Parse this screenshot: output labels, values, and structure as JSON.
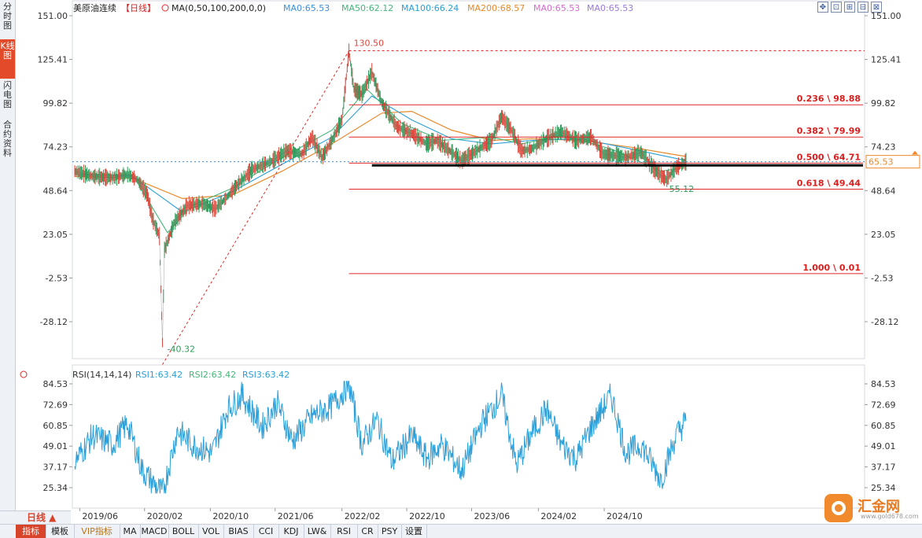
{
  "sidebar": {
    "tabs": [
      {
        "label": "分时图",
        "active": false
      },
      {
        "label": "K线图",
        "active": true
      },
      {
        "label": "闪电图",
        "active": false
      },
      {
        "label": "合约资料",
        "active": false
      }
    ]
  },
  "header": {
    "symbol": "美原油连续",
    "period_tag": "【日线】",
    "ma_label": "MA(0,50,100,200,0,0)",
    "ma_items": [
      {
        "text": "MA0:65.53",
        "color": "#3b8fd9"
      },
      {
        "text": "MA50:62.12",
        "color": "#46b57a"
      },
      {
        "text": "MA100:66.24",
        "color": "#2a9fd8"
      },
      {
        "text": "MA200:68.57",
        "color": "#e8892a"
      },
      {
        "text": "MA0:65.53",
        "color": "#d66ad0"
      },
      {
        "text": "MA0:65.53",
        "color": "#9a7ad8"
      }
    ]
  },
  "tools": [
    "✥",
    "⊡",
    "⊞",
    "⊟",
    "⊠"
  ],
  "price_axis": {
    "ticks": [
      "151.00",
      "125.41",
      "99.82",
      "74.23",
      "48.64",
      "23.05",
      "-2.53",
      "-28.12"
    ],
    "current": "65.53"
  },
  "annotations": {
    "high": "130.50",
    "low": "-40.32",
    "recent_low": "55.12"
  },
  "fib_levels": [
    {
      "label": "0.236 \\ 98.88",
      "value": 98.88
    },
    {
      "label": "0.382 \\ 79.99",
      "value": 79.99
    },
    {
      "label": "0.500 \\ 64.71",
      "value": 64.71
    },
    {
      "label": "0.618 \\ 49.44",
      "value": 49.44
    },
    {
      "label": "1.000 \\ 0.01",
      "value": 0.01
    }
  ],
  "rsi": {
    "label": "RSI(14,14,14)",
    "items": [
      {
        "text": "RSI1:63.42",
        "color": "#2a9fd8"
      },
      {
        "text": "RSI2:63.42",
        "color": "#46b57a"
      },
      {
        "text": "RSI3:63.42",
        "color": "#2a9fd8"
      }
    ],
    "ticks": [
      "84.53",
      "72.69",
      "60.85",
      "49.01",
      "37.17",
      "25.34"
    ]
  },
  "x_axis": {
    "labels": [
      "2019/06",
      "2020/02",
      "2020/10",
      "2021/06",
      "2022/02",
      "2022/10",
      "2023/06",
      "2024/02",
      "2024/10"
    ]
  },
  "period_button": "日线 ▲",
  "bottom_tabs": [
    {
      "label": "指标",
      "active": true
    },
    {
      "label": "模板"
    },
    {
      "label": "VIP指标",
      "vip": true
    },
    {
      "label": "MA"
    },
    {
      "label": "MACD"
    },
    {
      "label": "BOLL"
    },
    {
      "label": "VOL"
    },
    {
      "label": "BIAS"
    },
    {
      "label": "CCI"
    },
    {
      "label": "KDJ"
    },
    {
      "label": "LW&"
    },
    {
      "label": "RSI"
    },
    {
      "label": "CR"
    },
    {
      "label": "PSY"
    },
    {
      "label": "设置"
    }
  ],
  "logo": {
    "brand": "汇金网",
    "url": "www.gold678.com"
  },
  "chart_data": {
    "type": "line",
    "ylim": [
      -40.32,
      151.0
    ],
    "rsi_ylim": [
      20,
      90
    ],
    "price_path": [
      [
        2019.42,
        60
      ],
      [
        2019.6,
        57
      ],
      [
        2019.8,
        56
      ],
      [
        2019.95,
        58
      ],
      [
        2020.05,
        55
      ],
      [
        2020.15,
        46
      ],
      [
        2020.2,
        32
      ],
      [
        2020.27,
        22
      ],
      [
        2020.3,
        -40.32
      ],
      [
        2020.32,
        14
      ],
      [
        2020.42,
        30
      ],
      [
        2020.55,
        40
      ],
      [
        2020.7,
        41
      ],
      [
        2020.83,
        38
      ],
      [
        2020.95,
        45
      ],
      [
        2021.05,
        52
      ],
      [
        2021.2,
        61
      ],
      [
        2021.4,
        66
      ],
      [
        2021.55,
        72
      ],
      [
        2021.7,
        70
      ],
      [
        2021.8,
        80
      ],
      [
        2021.9,
        68
      ],
      [
        2022.0,
        78
      ],
      [
        2022.1,
        90
      ],
      [
        2022.17,
        130.5
      ],
      [
        2022.22,
        108
      ],
      [
        2022.3,
        105
      ],
      [
        2022.4,
        118
      ],
      [
        2022.5,
        100
      ],
      [
        2022.65,
        86
      ],
      [
        2022.8,
        82
      ],
      [
        2022.95,
        76
      ],
      [
        2023.05,
        78
      ],
      [
        2023.2,
        71
      ],
      [
        2023.3,
        66
      ],
      [
        2023.45,
        72
      ],
      [
        2023.6,
        78
      ],
      [
        2023.7,
        92
      ],
      [
        2023.8,
        84
      ],
      [
        2023.9,
        72
      ],
      [
        2024.0,
        73
      ],
      [
        2024.15,
        79
      ],
      [
        2024.3,
        83
      ],
      [
        2024.45,
        78
      ],
      [
        2024.6,
        80
      ],
      [
        2024.72,
        70
      ],
      [
        2024.85,
        69
      ],
      [
        2024.95,
        68
      ],
      [
        2025.1,
        71
      ],
      [
        2025.25,
        60
      ],
      [
        2025.35,
        55.12
      ],
      [
        2025.45,
        62
      ],
      [
        2025.55,
        65.53
      ]
    ],
    "rsi_path": [
      [
        2019.42,
        40
      ],
      [
        2019.6,
        55
      ],
      [
        2019.8,
        50
      ],
      [
        2019.95,
        62
      ],
      [
        2020.1,
        35
      ],
      [
        2020.3,
        22
      ],
      [
        2020.45,
        58
      ],
      [
        2020.6,
        50
      ],
      [
        2020.8,
        45
      ],
      [
        2020.95,
        70
      ],
      [
        2021.1,
        78
      ],
      [
        2021.3,
        60
      ],
      [
        2021.45,
        74
      ],
      [
        2021.6,
        52
      ],
      [
        2021.8,
        66
      ],
      [
        2022.0,
        72
      ],
      [
        2022.17,
        84.53
      ],
      [
        2022.3,
        50
      ],
      [
        2022.45,
        64
      ],
      [
        2022.6,
        40
      ],
      [
        2022.8,
        55
      ],
      [
        2022.95,
        42
      ],
      [
        2023.1,
        50
      ],
      [
        2023.3,
        35
      ],
      [
        2023.5,
        62
      ],
      [
        2023.7,
        78
      ],
      [
        2023.85,
        38
      ],
      [
        2024.0,
        56
      ],
      [
        2024.15,
        70
      ],
      [
        2024.3,
        50
      ],
      [
        2024.45,
        42
      ],
      [
        2024.6,
        60
      ],
      [
        2024.8,
        78
      ],
      [
        2024.95,
        45
      ],
      [
        2025.1,
        50
      ],
      [
        2025.3,
        30
      ],
      [
        2025.45,
        55
      ],
      [
        2025.55,
        63.42
      ]
    ],
    "ma200_path": [
      [
        2019.42,
        57
      ],
      [
        2020.0,
        56
      ],
      [
        2020.5,
        44
      ],
      [
        2021.0,
        46
      ],
      [
        2021.5,
        60
      ],
      [
        2022.0,
        76
      ],
      [
        2022.5,
        94
      ],
      [
        2022.8,
        95
      ],
      [
        2023.2,
        84
      ],
      [
        2023.6,
        78
      ],
      [
        2024.0,
        79
      ],
      [
        2024.5,
        78
      ],
      [
        2025.0,
        74
      ],
      [
        2025.55,
        68.57
      ]
    ],
    "ma100_path": [
      [
        2019.42,
        58
      ],
      [
        2020.0,
        57
      ],
      [
        2020.5,
        36
      ],
      [
        2021.0,
        48
      ],
      [
        2021.5,
        64
      ],
      [
        2022.0,
        80
      ],
      [
        2022.4,
        104
      ],
      [
        2022.8,
        90
      ],
      [
        2023.2,
        79
      ],
      [
        2023.6,
        76
      ],
      [
        2024.0,
        78
      ],
      [
        2024.5,
        79
      ],
      [
        2025.0,
        73
      ],
      [
        2025.55,
        66.24
      ]
    ],
    "ma50_path": [
      [
        2019.42,
        58
      ],
      [
        2020.0,
        58
      ],
      [
        2020.35,
        24
      ],
      [
        2020.6,
        40
      ],
      [
        2021.0,
        50
      ],
      [
        2021.5,
        68
      ],
      [
        2022.0,
        84
      ],
      [
        2022.35,
        108
      ],
      [
        2022.7,
        88
      ],
      [
        2023.1,
        78
      ],
      [
        2023.6,
        80
      ],
      [
        2023.9,
        76
      ],
      [
        2024.3,
        81
      ],
      [
        2024.8,
        73
      ],
      [
        2025.3,
        60
      ],
      [
        2025.55,
        62.12
      ]
    ]
  }
}
